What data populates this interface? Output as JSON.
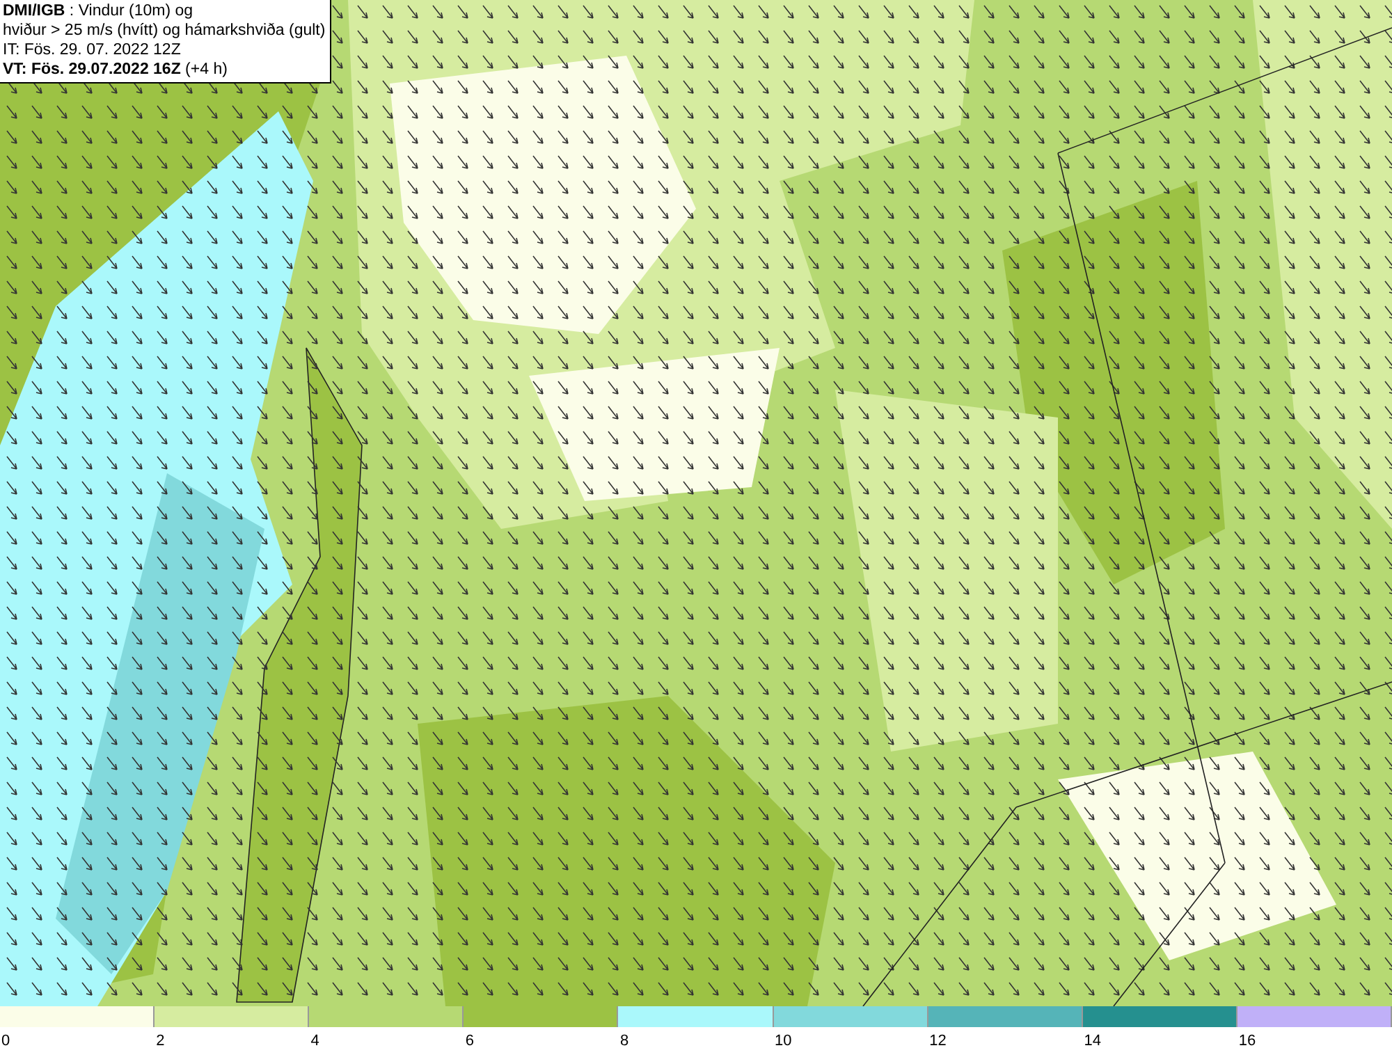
{
  "title_box": {
    "lines": [
      "**DMI/IGB** : Vindur (10m) og",
      "hviður > 25 m/s (hvítt) og hámarkshviða (gult)",
      "IT: Fös. 29. 07. 2022 12Z",
      "**VT: Fös. 29.07.2022 16Z** (+4 h)"
    ]
  },
  "legend": [
    {
      "label": "0",
      "color": "#fbfde8"
    },
    {
      "label": "2",
      "color": "#d6eca0"
    },
    {
      "label": "4",
      "color": "#b6d973"
    },
    {
      "label": "6",
      "color": "#9cc244"
    },
    {
      "label": "8",
      "color": "#aaf8fb"
    },
    {
      "label": "10",
      "color": "#82d9dc"
    },
    {
      "label": "12",
      "color": "#55b4b8"
    },
    {
      "label": "14",
      "color": "#25908f"
    },
    {
      "label": "16",
      "color": "#c0b0f8"
    }
  ]
}
